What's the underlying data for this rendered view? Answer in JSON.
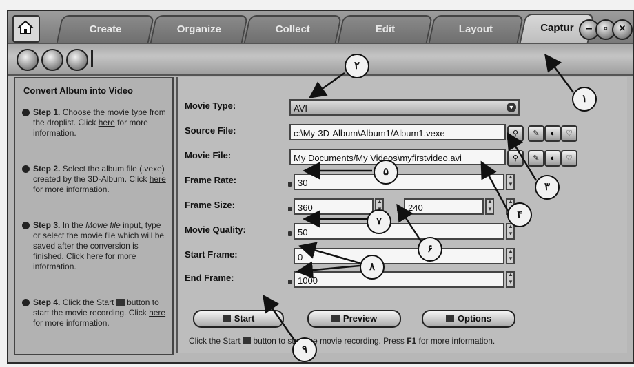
{
  "tabs": [
    {
      "label": "Create"
    },
    {
      "label": "Organize"
    },
    {
      "label": "Collect"
    },
    {
      "label": "Edit"
    },
    {
      "label": "Layout"
    },
    {
      "label": "Captur"
    }
  ],
  "left_panel": {
    "title": "Convert Album into Video",
    "steps": [
      {
        "step": "Step 1.",
        "text": "Choose the movie type from the droplist. Click",
        "link": "here",
        "text_after": "for more information."
      },
      {
        "step": "Step 2.",
        "text": "Select the album file (.vexe) created by the 3D-Album. Click",
        "link": "here",
        "text_after": "for more information."
      },
      {
        "step": "Step 3.",
        "text_pre": "In the",
        "italic": "Movie file",
        "text": "input, type or select the movie file which will be saved after the conversion is finished. Click",
        "link": "here",
        "text_after": "for more information."
      },
      {
        "step": "Step 4.",
        "text": "Click the Start",
        "text_mid": "button to start the movie recording. Click",
        "link": "here",
        "text_after": "for more information."
      }
    ]
  },
  "form": {
    "movie_type_label": "Movie Type:",
    "movie_type_value": "AVI",
    "source_file_label": "Source File:",
    "source_file_value": "c:\\My-3D-Album\\Album1/Album1.vexe",
    "movie_file_label": "Movie File:",
    "movie_file_value": "My Documents/My Videos\\myfirstvideo.avi",
    "frame_rate_label": "Frame Rate:",
    "frame_rate_value": "30",
    "frame_size_label": "Frame Size:",
    "frame_width_value": "360",
    "frame_height_value": "240",
    "movie_quality_label": "Movie Quality:",
    "movie_quality_value": "50",
    "start_frame_label": "Start Frame:",
    "start_frame_value": "0",
    "end_frame_label": "End Frame:",
    "end_frame_value": "1000"
  },
  "buttons": {
    "start": "Start",
    "preview": "Preview",
    "options": "Options"
  },
  "hint": {
    "pre": "Click the Start",
    "mid": "button to start the movie recording. Press",
    "key": "F1",
    "post": "for more information."
  },
  "callouts": [
    "١",
    "٢",
    "٣",
    "۴",
    "۵",
    "۶",
    "٧",
    "٨",
    "٩"
  ]
}
